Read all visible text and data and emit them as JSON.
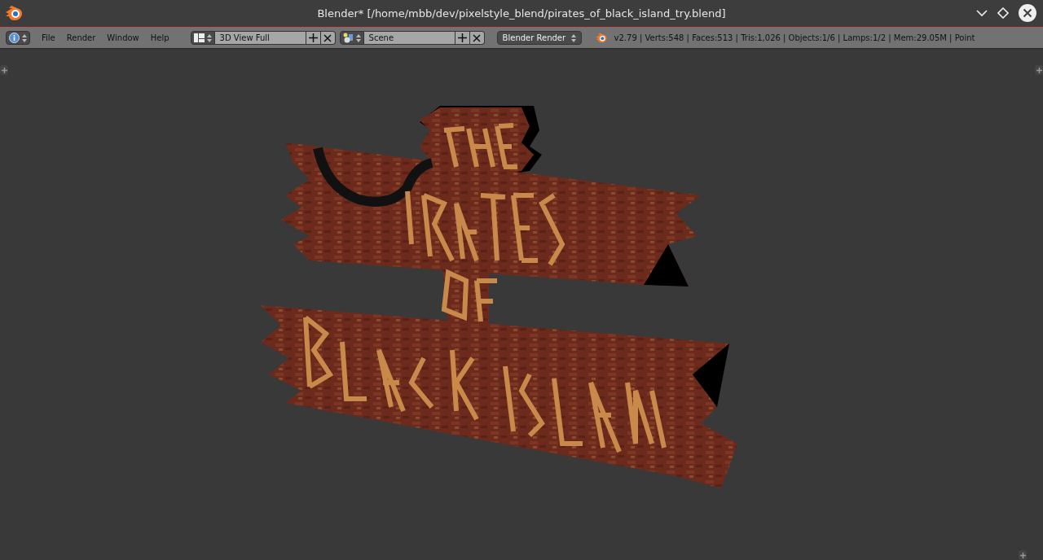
{
  "window": {
    "title": "Blender* [/home/mbb/dev/pixelstyle_blend/pirates_of_black_island_try.blend]"
  },
  "menu": [
    "File",
    "Render",
    "Window",
    "Help"
  ],
  "screen_layout": {
    "value": "3D View Full"
  },
  "scene": {
    "value": "Scene"
  },
  "render_engine": {
    "value": "Blender Render"
  },
  "stats": "v2.79 | Verts:548 | Faces:513 | Tris:1,026 | Objects:1/6 | Lamps:1/2 | Mem:29.05M | Point"
}
